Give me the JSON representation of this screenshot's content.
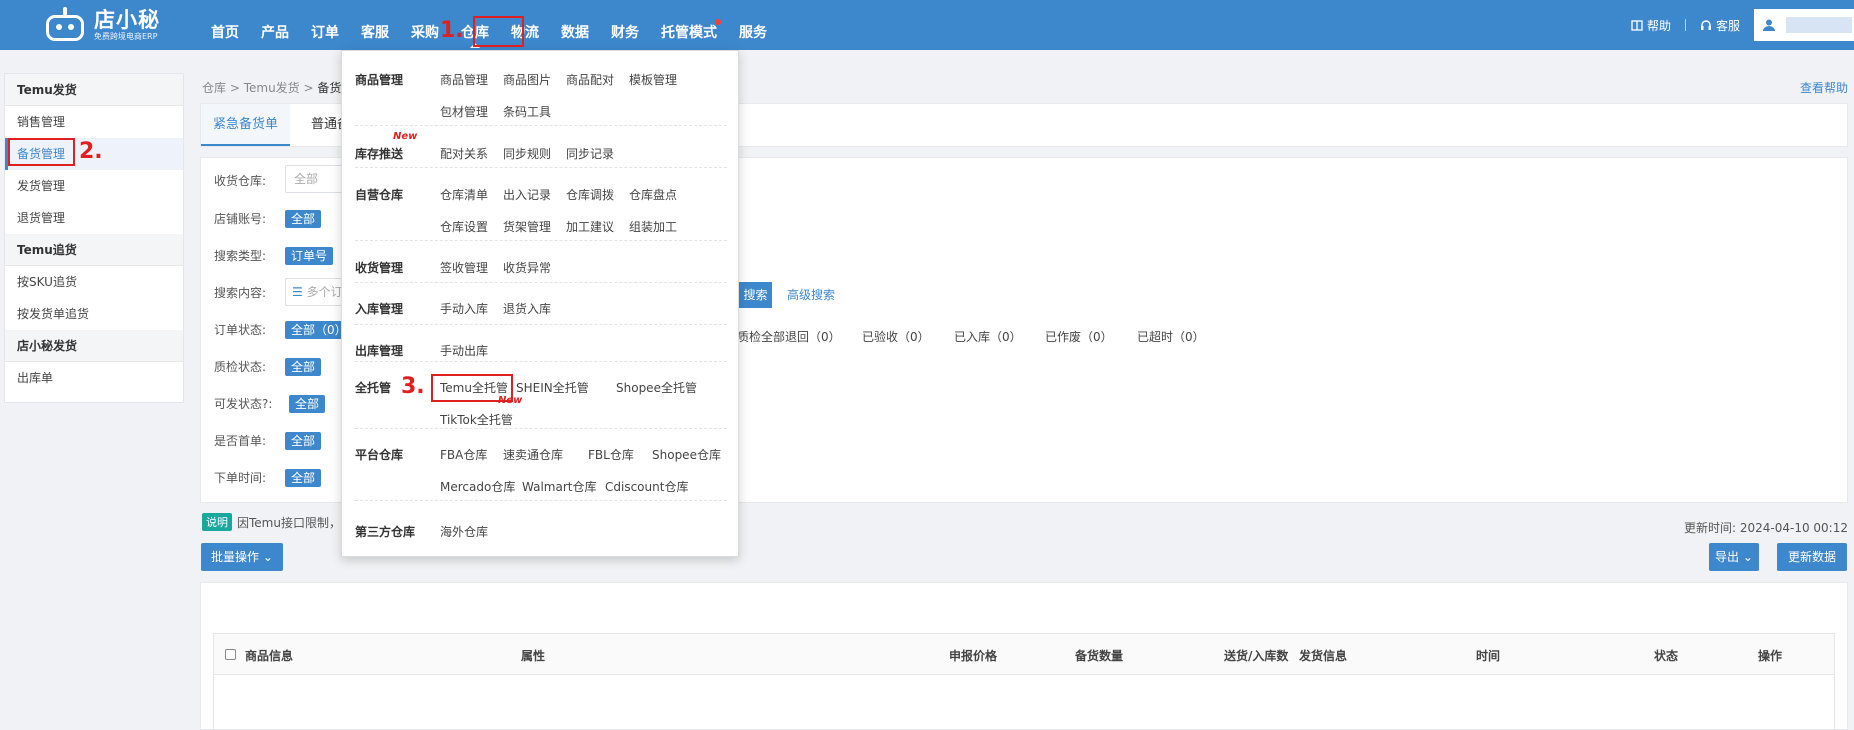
{
  "app": {
    "name": "店小秘",
    "tagline": "免费跨境电商ERP"
  },
  "nav": {
    "items": [
      "首页",
      "产品",
      "订单",
      "客服",
      "采购",
      "仓库",
      "物流",
      "数据",
      "财务",
      "托管模式",
      "服务"
    ],
    "help": "帮助",
    "service": "客服"
  },
  "sidebar": {
    "group1": "Temu发货",
    "items1": [
      "销售管理",
      "备货管理",
      "发货管理",
      "退货管理"
    ],
    "group2": "Temu追货",
    "items2": [
      "按SKU追货",
      "按发货单追货"
    ],
    "group3": "店小秘发货",
    "items3": [
      "出库单"
    ]
  },
  "breadcrumb": {
    "p1": "仓库",
    "p2": "Temu发货",
    "p3": "备货管"
  },
  "help_link": "查看帮助",
  "tabs": [
    "紧急备货单",
    "普通备货"
  ],
  "filters": {
    "warehouse_label": "收货仓库:",
    "warehouse_value": "全部",
    "shop_label": "店铺账号:",
    "search_type_label": "搜索类型:",
    "search_type_value": "订单号",
    "search_content_label": "搜索内容:",
    "search_placeholder": "多个订",
    "search_button": "搜索",
    "advanced_search": "高级搜索",
    "order_status_label": "订单状态:",
    "order_status_value": "全部（0）",
    "qc_status_label": "质检状态:",
    "ship_status_label": "可发状态",
    "first_order_label": "是否首单:",
    "order_time_label": "下单时间:",
    "all": "全部",
    "status_options": [
      "质检全部退回（0）",
      "已验收（0）",
      "已入库（0）",
      "已作废（0）",
      "已超时（0）"
    ]
  },
  "note": {
    "badge": "说明",
    "text": "因Temu接口限制，更"
  },
  "update_time": "更新时间: 2024-04-10 00:12",
  "buttons": {
    "batch": "批量操作",
    "export": "导出",
    "refresh": "更新数据"
  },
  "table_headers": [
    "商品信息",
    "属性",
    "申报价格",
    "备货数量",
    "送货/入库数",
    "发货信息",
    "时间",
    "状态",
    "操作"
  ],
  "dropdown": {
    "rows": [
      {
        "title": "商品管理",
        "links": [
          "商品管理",
          "商品图片",
          "商品配对",
          "模板管理",
          "包材管理",
          "条码工具"
        ]
      },
      {
        "title": "库存推送",
        "links": [
          "配对关系",
          "同步规则",
          "同步记录"
        ],
        "badge": "New"
      },
      {
        "title": "自营仓库",
        "links": [
          "仓库清单",
          "出入记录",
          "仓库调拨",
          "仓库盘点",
          "仓库设置",
          "货架管理",
          "加工建议",
          "组装加工"
        ]
      },
      {
        "title": "收货管理",
        "links": [
          "签收管理",
          "收货异常"
        ]
      },
      {
        "title": "入库管理",
        "links": [
          "手动入库",
          "退货入库"
        ]
      },
      {
        "title": "出库管理",
        "links": [
          "手动出库"
        ]
      },
      {
        "title": "全托管",
        "links": [
          "Temu全托管",
          "SHEIN全托管",
          "Shopee全托管",
          "TikTok全托管"
        ],
        "badge": "New"
      },
      {
        "title": "平台仓库",
        "links": [
          "FBA仓库",
          "速卖通仓库",
          "FBL仓库",
          "Shopee仓库",
          "Mercado仓库",
          "Walmart仓库",
          "Cdiscount仓库"
        ]
      },
      {
        "title": "第三方仓库",
        "links": [
          "海外仓库"
        ]
      }
    ]
  },
  "annotations": [
    "1.",
    "2.",
    "3."
  ],
  "colors": {
    "primary": "#3d87cd",
    "annotation": "#e02020",
    "note_badge": "#19a89d"
  }
}
